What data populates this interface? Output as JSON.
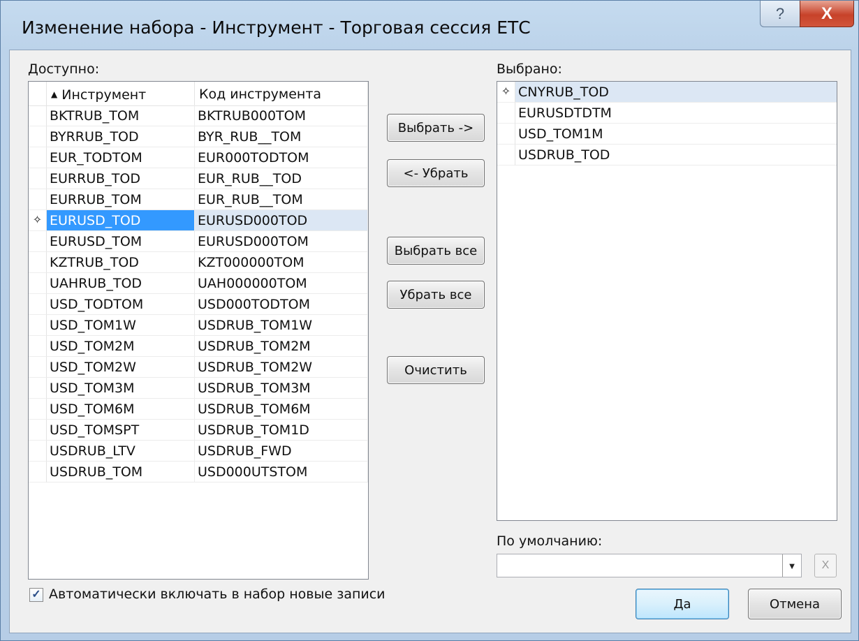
{
  "window": {
    "title": "Изменение набора - Инструмент - Торговая сессия ЕТС",
    "help_icon": "?",
    "close_icon": "X"
  },
  "available": {
    "label": "Доступно:",
    "columns": [
      "Инструмент",
      "Код инструмента"
    ],
    "sort_indicator": "▲",
    "current_row_icon": "✧",
    "rows": [
      {
        "instrument": "BKTRUB_TOM",
        "code": "BKTRUB000TOM"
      },
      {
        "instrument": "BYRRUB_TOD",
        "code": "BYR_RUB__TOM"
      },
      {
        "instrument": "EUR_TODTOM",
        "code": "EUR000TODTOM"
      },
      {
        "instrument": "EURRUB_TOD",
        "code": "EUR_RUB__TOD"
      },
      {
        "instrument": "EURRUB_TOM",
        "code": "EUR_RUB__TOM"
      },
      {
        "instrument": "EURUSD_TOD",
        "code": "EURUSD000TOD"
      },
      {
        "instrument": "EURUSD_TOM",
        "code": "EURUSD000TOM"
      },
      {
        "instrument": "KZTRUB_TOD",
        "code": "KZT000000TOM"
      },
      {
        "instrument": "UAHRUB_TOD",
        "code": "UAH000000TOM"
      },
      {
        "instrument": "USD_TODTOM",
        "code": "USD000TODTOM"
      },
      {
        "instrument": "USD_TOM1W",
        "code": "USDRUB_TOM1W"
      },
      {
        "instrument": "USD_TOM2M",
        "code": "USDRUB_TOM2M"
      },
      {
        "instrument": "USD_TOM2W",
        "code": "USDRUB_TOM2W"
      },
      {
        "instrument": "USD_TOM3M",
        "code": "USDRUB_TOM3M"
      },
      {
        "instrument": "USD_TOM6M",
        "code": "USDRUB_TOM6M"
      },
      {
        "instrument": "USD_TOMSPT",
        "code": "USDRUB_TOM1D"
      },
      {
        "instrument": "USDRUB_LTV",
        "code": "USDRUB_FWD"
      },
      {
        "instrument": "USDRUB_TOM",
        "code": "USD000UTSTOM"
      }
    ]
  },
  "buttons": {
    "select": "Выбрать ->",
    "remove": "<- Убрать",
    "select_all": "Выбрать все",
    "remove_all": "Убрать все",
    "clear": "Очистить",
    "ok": "Да",
    "cancel": "Отмена"
  },
  "selected": {
    "label": "Выбрано:",
    "current_row_icon": "✧",
    "rows": [
      "CNYRUB_TOD",
      "EURUSDTDTM",
      "USD_TOM1M",
      "USDRUB_TOD"
    ]
  },
  "default": {
    "label": "По умолчанию:",
    "value": "",
    "dropdown_icon": "▼",
    "clear_icon": "X"
  },
  "auto_include": {
    "checked": true,
    "check_glyph": "✓",
    "label": "Автоматически включать в набор новые записи"
  }
}
